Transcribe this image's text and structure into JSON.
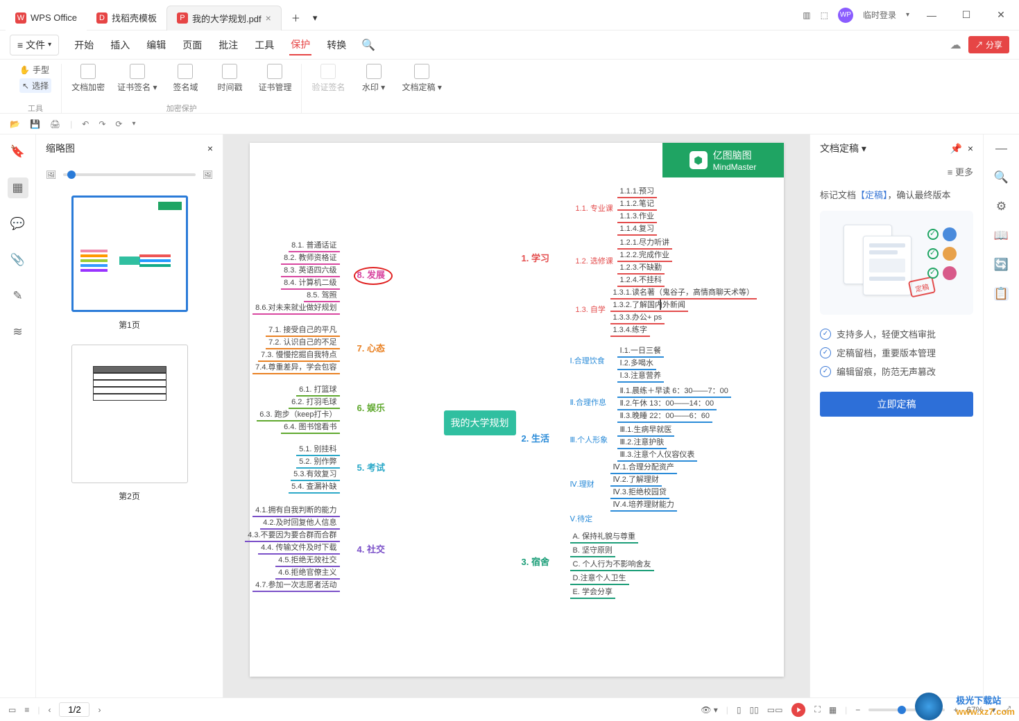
{
  "title": {
    "appName": "WPS Office",
    "tab1": "找稻壳模板",
    "tab2": "我的大学规划.pdf",
    "loginText": "临时登录"
  },
  "menu": {
    "file": "文件",
    "items": [
      "开始",
      "插入",
      "编辑",
      "页面",
      "批注",
      "工具",
      "保护",
      "转换"
    ],
    "activeIndex": 6,
    "share": "分享"
  },
  "ribbon": {
    "hand": "手型",
    "select": "选择",
    "toolsLabel": "工具",
    "encrypt": "文档加密",
    "certSign": "证书签名",
    "signField": "签名域",
    "timestamp": "时间戳",
    "certMgr": "证书管理",
    "encryptGroupLabel": "加密保护",
    "verifySign": "验证签名",
    "watermark": "水印",
    "finalize": "文档定稿"
  },
  "thumbs": {
    "header": "缩略图",
    "page1": "第1页",
    "page2": "第2页"
  },
  "rpanel": {
    "header": "文档定稿",
    "more": "更多",
    "notePre": "标记文档",
    "noteHl": "【定稿】",
    "notePost": "，确认最终版本",
    "stamp": "定稿",
    "b1": "支持多人，轻便文档审批",
    "b2": "定稿留档，重要版本管理",
    "b3": "编辑留痕，防范无声篡改",
    "cta": "立即定稿"
  },
  "mindmap": {
    "brandTop": "亿图脑图",
    "brandBottom": "MindMaster",
    "center": "我的大学规划",
    "right": {
      "b1": {
        "label": "1. 学习",
        "children": {
          "c11": {
            "label": "1.1. 专业课",
            "leaves": [
              "1.1.1.预习",
              "1.1.2.笔记",
              "1.1.3.作业",
              "1.1.4.复习"
            ]
          },
          "c12": {
            "label": "1.2. 选修课",
            "leaves": [
              "1.2.1.尽力听讲",
              "1.2.2.完成作业",
              "1.2.3.不缺勤",
              "1.2.4.不挂科"
            ]
          },
          "c13": {
            "label": "1.3. 自学",
            "leaves": [
              "1.3.1.读名著（鬼谷子，高情商聊天术等）",
              "1.3.2.了解国内外新闻",
              "1.3.3.办公+ ps",
              "1.3.4.练字"
            ]
          }
        }
      },
      "b2": {
        "label": "2. 生活",
        "children": {
          "c21": {
            "label": "Ⅰ.合理饮食",
            "leaves": [
              "Ⅰ.1.一日三餐",
              "Ⅰ.2.多喝水",
              "Ⅰ.3.注意营养"
            ]
          },
          "c22": {
            "label": "Ⅱ.合理作息",
            "leaves": [
              "Ⅱ.1.晨练＋早读 6：30——7：00",
              "Ⅱ.2.午休 13：00——14：00",
              "Ⅱ.3.晚睡 22：00——6：60"
            ]
          },
          "c23": {
            "label": "Ⅲ.个人形象",
            "leaves": [
              "Ⅲ.1.生病早就医",
              "Ⅲ.2.注意护肤",
              "Ⅲ.3.注意个人仪容仪表"
            ]
          },
          "c24": {
            "label": "Ⅳ.理财",
            "leaves": [
              "Ⅳ.1.合理分配资产",
              "Ⅳ.2.了解理财",
              "Ⅳ.3.拒绝校园贷",
              "Ⅳ.4.培养理财能力"
            ]
          },
          "c25": {
            "label": "Ⅴ.待定",
            "leaves": []
          }
        }
      },
      "b3": {
        "label": "3. 宿舍",
        "leaves": [
          "A. 保持礼貌与尊重",
          "B. 坚守原则",
          "C. 个人行为不影响舍友",
          "D.注意个人卫生",
          "E. 学会分享"
        ]
      }
    },
    "left": {
      "b8": {
        "label": "8. 发展",
        "leaves": [
          "8.1. 普通话证",
          "8.2. 教师资格证",
          "8.3. 英语四六级",
          "8.4. 计算机二级",
          "8.5. 驾照",
          "8.6.对未来就业做好规划"
        ]
      },
      "b7": {
        "label": "7. 心态",
        "leaves": [
          "7.1. 接受自己的平凡",
          "7.2. 认识自己的不足",
          "7.3. 慢慢挖掘自我特点",
          "7.4.尊重差异，学会包容"
        ]
      },
      "b6": {
        "label": "6. 娱乐",
        "leaves": [
          "6.1. 打篮球",
          "6.2. 打羽毛球",
          "6.3. 跑步（keep打卡）",
          "6.4. 图书馆看书"
        ]
      },
      "b5": {
        "label": "5. 考试",
        "leaves": [
          "5.1. 别挂科",
          "5.2. 别作弊",
          "5.3.有效复习",
          "5.4. 查漏补缺"
        ]
      },
      "b4": {
        "label": "4. 社交",
        "leaves": [
          "4.1.拥有自我判断的能力",
          "4.2.及时回复他人信息",
          "4.3.不要因为要合群而合群",
          "4.4. 传输文件及时下载",
          "4.5.拒绝无效社交",
          "4.6.拒绝官僚主义",
          "4.7.参加一次志愿者活动"
        ]
      }
    }
  },
  "status": {
    "pageInput": "1/2",
    "zoom": "67%"
  },
  "watermark": {
    "text": "极光下载站",
    "url": "www.xz7.com"
  }
}
